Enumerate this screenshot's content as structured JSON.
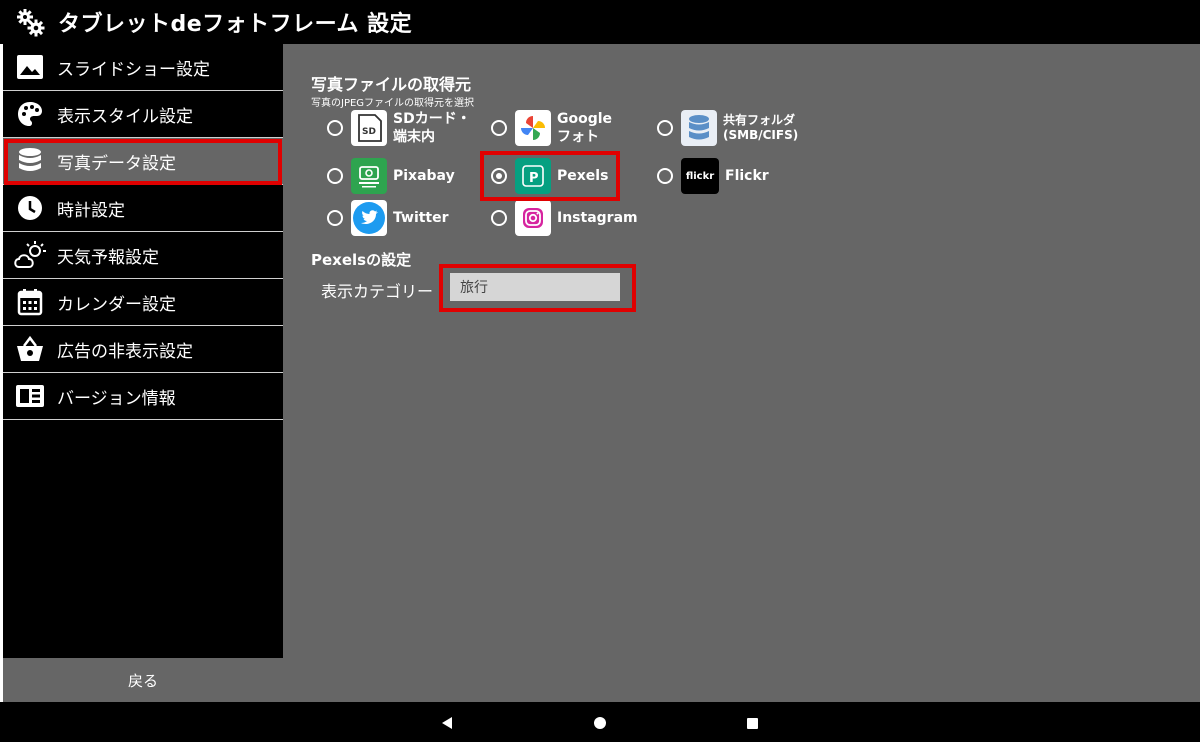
{
  "app": {
    "title": "タブレットdeフォトフレーム 設定"
  },
  "sidebar": {
    "items": [
      {
        "label": "スライドショー設定",
        "icon": "image-icon"
      },
      {
        "label": "表示スタイル設定",
        "icon": "palette-icon"
      },
      {
        "label": "写真データ設定",
        "icon": "database-icon",
        "active": true
      },
      {
        "label": "時計設定",
        "icon": "clock-icon"
      },
      {
        "label": "天気予報設定",
        "icon": "weather-icon"
      },
      {
        "label": "カレンダー設定",
        "icon": "calendar-icon"
      },
      {
        "label": "広告の非表示設定",
        "icon": "basket-icon"
      },
      {
        "label": "バージョン情報",
        "icon": "info-card-icon"
      }
    ],
    "back_label": "戻る"
  },
  "source": {
    "title": "写真ファイルの取得元",
    "subtitle": "写真のJPEGファイルの取得元を選択",
    "options": [
      {
        "label_line1": "SDカード・",
        "label_line2": "端末内",
        "icon": "sd-card-icon",
        "logo_text": "SD",
        "selected": false
      },
      {
        "label_line1": "Google",
        "label_line2": "フォト",
        "icon": "google-photos-icon",
        "selected": false
      },
      {
        "label_line1": "共有フォルダ",
        "label_line2": "(SMB/CIFS)",
        "icon": "shared-folder-icon",
        "selected": false
      },
      {
        "label": "Pixabay",
        "icon": "pixabay-icon",
        "selected": false
      },
      {
        "label": "Pexels",
        "icon": "pexels-icon",
        "logo_text": "P",
        "selected": true
      },
      {
        "label": "Flickr",
        "icon": "flickr-icon",
        "logo_text": "flickr",
        "selected": false
      },
      {
        "label": "Twitter",
        "icon": "twitter-icon",
        "selected": false
      },
      {
        "label": "Instagram",
        "icon": "instagram-icon",
        "selected": false
      }
    ]
  },
  "pexels": {
    "title": "Pexelsの設定",
    "category_label": "表示カテゴリー",
    "category_value": "旅行"
  },
  "colors": {
    "highlight": "#e00000",
    "panel": "#666666",
    "pexels": "#05a081"
  }
}
